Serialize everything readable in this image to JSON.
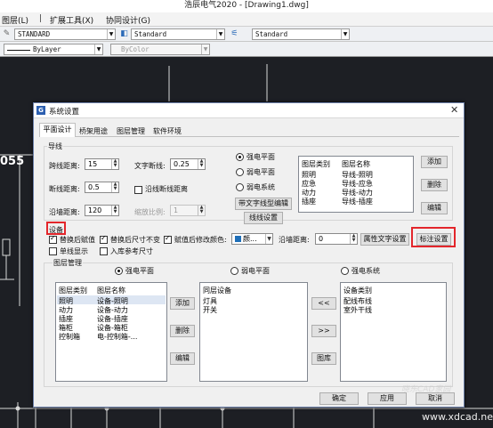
{
  "window": {
    "title": "浩辰电气2020 - [Drawing1.dwg]"
  },
  "menubar": {
    "items": [
      "图层(L)",
      "扩展工具(X)",
      "协同设计(G)"
    ]
  },
  "toolbar": {
    "text_style": "STANDARD",
    "dim_style": "Standard",
    "table_style": "Standard",
    "linetype": "ByLayer",
    "color": "ByColor"
  },
  "canvas": {
    "label": "055"
  },
  "dialog": {
    "title": "系统设置",
    "tabs": [
      "平面设计",
      "桥架用途",
      "图层管理",
      "软件环境"
    ],
    "wiring": {
      "section": "导线",
      "span_label": "跨线距离:",
      "span_value": "15",
      "break_label": "断线距离:",
      "break_value": "0.5",
      "wall_label": "沿墙距离:",
      "wall_value": "120",
      "text_break_label": "文字断线:",
      "text_break_value": "0.25",
      "along_break_label": "沿线断线距离",
      "scale_label": "缩放比例:",
      "scale_value": "1",
      "radios": [
        "强电平面",
        "弱电平面",
        "弱电系统"
      ],
      "linetype_button": "带文字线型编辑",
      "system_button": "线线设置",
      "table_headers": [
        "图层类别",
        "图层名称"
      ],
      "table_rows": [
        [
          "照明",
          "导线-照明"
        ],
        [
          "应急",
          "导线-应急"
        ],
        [
          "动力",
          "导线-动力"
        ],
        [
          "插座",
          "导线-插座"
        ]
      ],
      "add": "添加",
      "delete": "删除",
      "edit": "编辑"
    },
    "equipment": {
      "section": "设备",
      "replace_assign": "替换后赋值",
      "replace_keep_size": "替换后尺寸不变",
      "scale_color": "赋值后修改颜色:",
      "color_value": "颜...",
      "wall_label": "沿墙距离:",
      "wall_value": "0",
      "attr_text_button": "属性文字设置",
      "dim_button": "标注设置",
      "single_line": "单线显示",
      "insert_ref": "入库参考尺寸"
    },
    "layers": {
      "section": "图层管理",
      "radios": [
        "强电平面",
        "弱电平面",
        "强电系统"
      ],
      "left_headers": [
        "图层类别",
        "图层名称"
      ],
      "left_rows": [
        [
          "照明",
          "设备-照明"
        ],
        [
          "动力",
          "设备-动力"
        ],
        [
          "插座",
          "设备-插座"
        ],
        [
          "箱柜",
          "设备-箱柜"
        ],
        [
          "控制箱",
          "电-控制箱-..."
        ]
      ],
      "add": "添加",
      "delete": "删除",
      "edit": "编辑",
      "mid_header": "同层设备",
      "mid_rows": [
        "灯具",
        "开关"
      ],
      "move_left": "<<",
      "move_right": ">>",
      "lib_button": "图库",
      "right_header": "设备类别",
      "right_rows": [
        "配线布线",
        "室外干线"
      ]
    },
    "ok": "确定",
    "apply": "应用",
    "cancel": "取消"
  },
  "watermark": {
    "text": "www.xdcad.net",
    "brand": "晓东CAD家园"
  }
}
